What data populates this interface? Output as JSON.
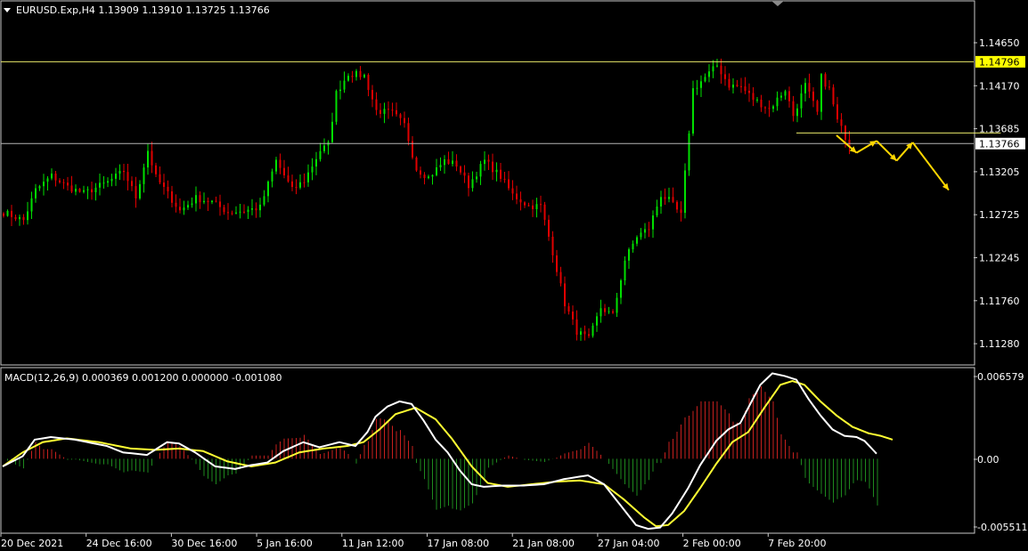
{
  "colors": {
    "background": "#000000",
    "frame": "#c8c8c8",
    "bull": "#00e000",
    "bear": "#e00000",
    "level": "#e8e86a",
    "price_line": "#b4b4b4",
    "arrow": "#ffd700",
    "macd_line": "#ffffff",
    "signal_line": "#ffff33",
    "hist_pos": "#c8201e",
    "hist_neg": "#1e8a1e",
    "tag_high_bg": "#ffff00",
    "tag_price_bg": "#ffffff"
  },
  "chart_data": [
    {
      "type": "candlestick",
      "title": "EURUSD.Exp,H4  1.13909 1.13910 1.13725 1.13766",
      "ylim": [
        1.1109,
        1.1526
      ],
      "y_ticks": [
        "1.14650",
        "1.14170",
        "1.13685",
        "1.13205",
        "1.12725",
        "1.12245",
        "1.11760",
        "1.11280"
      ],
      "x_ticks": [
        "20 Dec 2021",
        "24 Dec 16:00",
        "30 Dec 16:00",
        "5 Jan 16:00",
        "11 Jan 12:00",
        "17 Jan 08:00",
        "21 Jan 08:00",
        "27 Jan 04:00",
        "2 Feb 00:00",
        "7 Feb 20:00"
      ],
      "close_anchors": [
        [
          0,
          1.129
        ],
        [
          5,
          1.128
        ],
        [
          8,
          1.1318
        ],
        [
          12,
          1.1336
        ],
        [
          16,
          1.1322
        ],
        [
          20,
          1.1314
        ],
        [
          26,
          1.1328
        ],
        [
          30,
          1.1342
        ],
        [
          33,
          1.1309
        ],
        [
          36,
          1.1368
        ],
        [
          38,
          1.1334
        ],
        [
          44,
          1.1292
        ],
        [
          48,
          1.1308
        ],
        [
          52,
          1.1303
        ],
        [
          56,
          1.129
        ],
        [
          60,
          1.1292
        ],
        [
          64,
          1.1296
        ],
        [
          68,
          1.1355
        ],
        [
          72,
          1.1318
        ],
        [
          75,
          1.133
        ],
        [
          79,
          1.1368
        ],
        [
          81,
          1.1375
        ],
        [
          83,
          1.144
        ],
        [
          86,
          1.1465
        ],
        [
          90,
          1.1462
        ],
        [
          93,
          1.1418
        ],
        [
          97,
          1.1415
        ],
        [
          100,
          1.14
        ],
        [
          103,
          1.1345
        ],
        [
          106,
          1.1334
        ],
        [
          110,
          1.1355
        ],
        [
          113,
          1.135
        ],
        [
          116,
          1.1324
        ],
        [
          120,
          1.1355
        ],
        [
          124,
          1.1335
        ],
        [
          127,
          1.1312
        ],
        [
          131,
          1.1298
        ],
        [
          134,
          1.1298
        ],
        [
          137,
          1.124
        ],
        [
          140,
          1.1175
        ],
        [
          143,
          1.114
        ],
        [
          146,
          1.113
        ],
        [
          149,
          1.117
        ],
        [
          152,
          1.116
        ],
        [
          155,
          1.123
        ],
        [
          158,
          1.126
        ],
        [
          161,
          1.127
        ],
        [
          164,
          1.1312
        ],
        [
          166,
          1.1305
        ],
        [
          169,
          1.1286
        ],
        [
          172,
          1.1445
        ],
        [
          175,
          1.146
        ],
        [
          178,
          1.1475
        ],
        [
          181,
          1.145
        ],
        [
          184,
          1.1448
        ],
        [
          187,
          1.1433
        ],
        [
          191,
          1.142
        ],
        [
          195,
          1.1445
        ],
        [
          197,
          1.1412
        ],
        [
          200,
          1.145
        ],
        [
          203,
          1.1415
        ],
        [
          204,
          1.146
        ],
        [
          206,
          1.1445
        ],
        [
          208,
          1.1405
        ],
        [
          211,
          1.1376
        ]
      ],
      "levels": {
        "resistance": 1.14796,
        "resistance_label": "1.14796",
        "current_price": 1.13766,
        "current_label": "1.13766",
        "support_segment": {
          "value": 1.139,
          "from_bar": 198,
          "to_bar": 249
        }
      },
      "projection": [
        [
          208,
          1.1387
        ],
        [
          213,
          1.1365
        ],
        [
          218,
          1.138
        ],
        [
          223,
          1.1355
        ],
        [
          227,
          1.1378
        ],
        [
          236,
          1.1318
        ]
      ]
    },
    {
      "type": "macd",
      "title": "MACD(12,26,9) 0.000369 0.001200 0.000000 -0.001080",
      "ylim": [
        -0.0057,
        0.0068
      ],
      "y_ticks": [
        "0.006579",
        "0.00",
        "-0.005511"
      ],
      "macd_anchors": [
        [
          0,
          -0.0006
        ],
        [
          5,
          0.0002
        ],
        [
          8,
          0.0015
        ],
        [
          12,
          0.0017
        ],
        [
          18,
          0.0015
        ],
        [
          26,
          0.001
        ],
        [
          30,
          0.0005
        ],
        [
          36,
          0.0003
        ],
        [
          41,
          0.0013
        ],
        [
          44,
          0.0012
        ],
        [
          48,
          0.0005
        ],
        [
          53,
          -0.0006
        ],
        [
          58,
          -0.0008
        ],
        [
          62,
          -0.0005
        ],
        [
          66,
          -0.0003
        ],
        [
          70,
          0.0006
        ],
        [
          75,
          0.0013
        ],
        [
          79,
          0.0009
        ],
        [
          84,
          0.0013
        ],
        [
          88,
          0.001
        ],
        [
          91,
          0.0021
        ],
        [
          93,
          0.0033
        ],
        [
          96,
          0.0041
        ],
        [
          99,
          0.0045
        ],
        [
          102,
          0.0043
        ],
        [
          105,
          0.003
        ],
        [
          108,
          0.0015
        ],
        [
          111,
          0.0005
        ],
        [
          114,
          -0.0009
        ],
        [
          117,
          -0.002
        ],
        [
          120,
          -0.0022
        ],
        [
          125,
          -0.0021
        ],
        [
          130,
          -0.0021
        ],
        [
          135,
          -0.002
        ],
        [
          140,
          -0.0016
        ],
        [
          146,
          -0.0013
        ],
        [
          150,
          -0.002
        ],
        [
          154,
          -0.0036
        ],
        [
          158,
          -0.0052
        ],
        [
          161,
          -0.0055
        ],
        [
          164,
          -0.0054
        ],
        [
          167,
          -0.0043
        ],
        [
          171,
          -0.0023
        ],
        [
          174,
          -0.0005
        ],
        [
          178,
          0.0014
        ],
        [
          181,
          0.0023
        ],
        [
          184,
          0.0028
        ],
        [
          186,
          0.004
        ],
        [
          189,
          0.0058
        ],
        [
          192,
          0.0067
        ],
        [
          195,
          0.0065
        ],
        [
          198,
          0.0062
        ],
        [
          201,
          0.0047
        ],
        [
          204,
          0.0034
        ],
        [
          207,
          0.0023
        ],
        [
          210,
          0.0018
        ],
        [
          213,
          0.0017
        ],
        [
          215,
          0.0014
        ],
        [
          218,
          0.0004
        ]
      ],
      "signal_anchors": [
        [
          0,
          -0.0006
        ],
        [
          5,
          0.0005
        ],
        [
          10,
          0.0013
        ],
        [
          16,
          0.0016
        ],
        [
          24,
          0.0013
        ],
        [
          32,
          0.0008
        ],
        [
          38,
          0.0007
        ],
        [
          44,
          0.0008
        ],
        [
          50,
          0.0006
        ],
        [
          56,
          -0.0002
        ],
        [
          62,
          -0.0006
        ],
        [
          68,
          -0.0003
        ],
        [
          74,
          0.0005
        ],
        [
          80,
          0.0008
        ],
        [
          86,
          0.001
        ],
        [
          90,
          0.0013
        ],
        [
          94,
          0.0023
        ],
        [
          98,
          0.0035
        ],
        [
          103,
          0.004
        ],
        [
          108,
          0.0031
        ],
        [
          112,
          0.0016
        ],
        [
          117,
          -0.0006
        ],
        [
          121,
          -0.0019
        ],
        [
          126,
          -0.0022
        ],
        [
          132,
          -0.002
        ],
        [
          138,
          -0.0018
        ],
        [
          144,
          -0.0017
        ],
        [
          150,
          -0.002
        ],
        [
          155,
          -0.0032
        ],
        [
          160,
          -0.0046
        ],
        [
          163,
          -0.0053
        ],
        [
          166,
          -0.0052
        ],
        [
          170,
          -0.0041
        ],
        [
          174,
          -0.0023
        ],
        [
          178,
          -0.0004
        ],
        [
          182,
          0.0013
        ],
        [
          186,
          0.0021
        ],
        [
          190,
          0.004
        ],
        [
          194,
          0.0058
        ],
        [
          197,
          0.0061
        ],
        [
          200,
          0.0058
        ],
        [
          204,
          0.0045
        ],
        [
          208,
          0.0034
        ],
        [
          212,
          0.0025
        ],
        [
          216,
          0.002
        ],
        [
          219,
          0.0018
        ],
        [
          222,
          0.0015
        ]
      ],
      "hist_scale": 2.5
    }
  ]
}
